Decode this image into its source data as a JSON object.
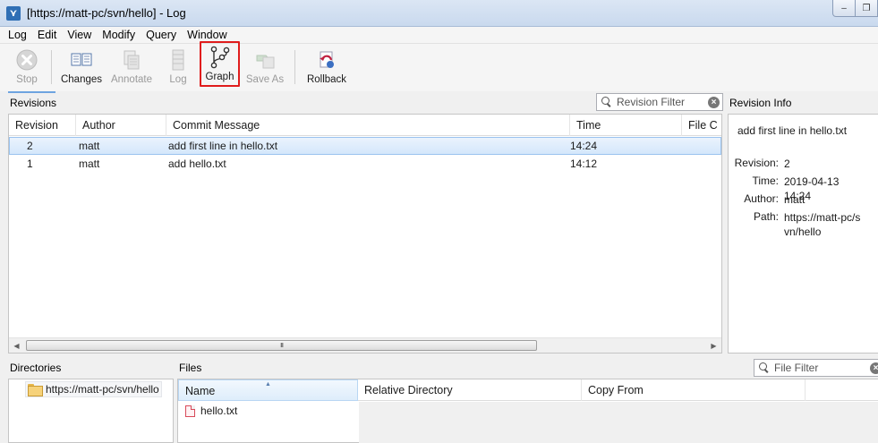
{
  "window": {
    "title": "[https://matt-pc/svn/hello] - Log",
    "app_icon": "tortoise-svn-icon",
    "minimize": "–",
    "restore": "❐"
  },
  "menu": [
    "Log",
    "Edit",
    "View",
    "Modify",
    "Query",
    "Window"
  ],
  "toolbar": {
    "stop": "Stop",
    "changes": "Changes",
    "annotate": "Annotate",
    "log": "Log",
    "graph": "Graph",
    "save_as": "Save As",
    "rollback": "Rollback"
  },
  "revisions_panel": {
    "title": "Revisions",
    "filter_placeholder": "Revision Filter",
    "columns": [
      "Revision",
      "Author",
      "Commit Message",
      "Time",
      "File C"
    ],
    "rows": [
      {
        "revision": "2",
        "author": "matt",
        "message": "add first line in hello.txt",
        "time": "14:24"
      },
      {
        "revision": "1",
        "author": "matt",
        "message": "add hello.txt",
        "time": "14:12"
      }
    ],
    "scroll_grip": "III"
  },
  "info_panel": {
    "title": "Revision Info",
    "message": "add first line in hello.txt",
    "revision_label": "Revision:",
    "revision_value": "2",
    "time_label": "Time:",
    "time_value": "2019-04-13 14:24",
    "author_label": "Author:",
    "author_value": "matt",
    "path_label": "Path:",
    "path_value": "https://matt-pc/svn/hello"
  },
  "directories_panel": {
    "title": "Directories",
    "item": "https://matt-pc/svn/hello"
  },
  "files_panel": {
    "title": "Files",
    "filter_placeholder": "File Filter",
    "columns": [
      "Name",
      "Relative Directory",
      "Copy From"
    ],
    "files": [
      {
        "name": "hello.txt"
      }
    ]
  },
  "colors": {
    "highlight_box": "#e01c1c",
    "selection": "#d4e7fb",
    "tab_underline": "#6ea4e0"
  }
}
